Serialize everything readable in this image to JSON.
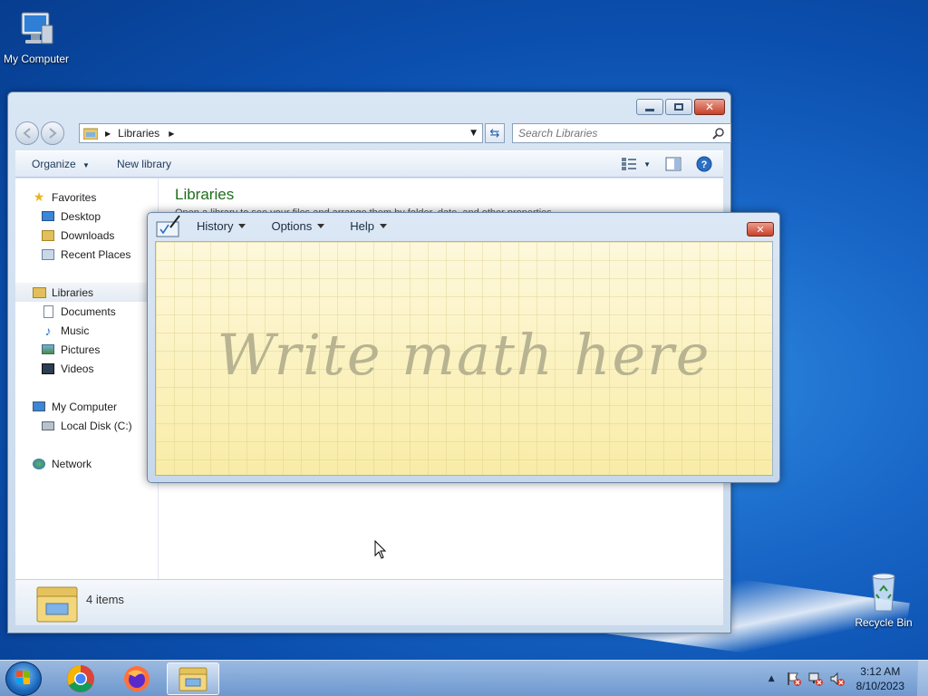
{
  "desktop": {
    "icons": [
      {
        "label": "My Computer",
        "icon": "my-computer-icon"
      },
      {
        "label": "Recycle Bin",
        "icon": "recycle-bin-icon"
      }
    ]
  },
  "explorer": {
    "address_crumb": "Libraries",
    "search_placeholder": "Search Libraries",
    "toolbar": {
      "organize": "Organize",
      "new_library": "New library"
    },
    "nav": {
      "favorites": "Favorites",
      "desktop": "Desktop",
      "downloads": "Downloads",
      "recent_places": "Recent Places",
      "libraries": "Libraries",
      "documents": "Documents",
      "music": "Music",
      "pictures": "Pictures",
      "videos": "Videos",
      "my_computer": "My Computer",
      "local_disk": "Local Disk (C:)",
      "network": "Network"
    },
    "content_title": "Libraries",
    "content_subtitle": "Open a library to see your files and arrange them by folder, date, and other properties.",
    "item_count": "4 items"
  },
  "math_panel": {
    "menu": {
      "history": "History",
      "options": "Options",
      "help": "Help"
    },
    "canvas_prompt": "Write math here"
  },
  "taskbar": {
    "apps": [
      "chrome-icon",
      "firefox-icon",
      "file-explorer-icon"
    ],
    "time": "3:12 AM",
    "date": "8/10/2023"
  },
  "colors": {
    "wallpaper": "#1866c7",
    "library_title": "#1d6e1d",
    "canvas_bg": "#fcf5cd",
    "close_button": "#c8402a"
  }
}
